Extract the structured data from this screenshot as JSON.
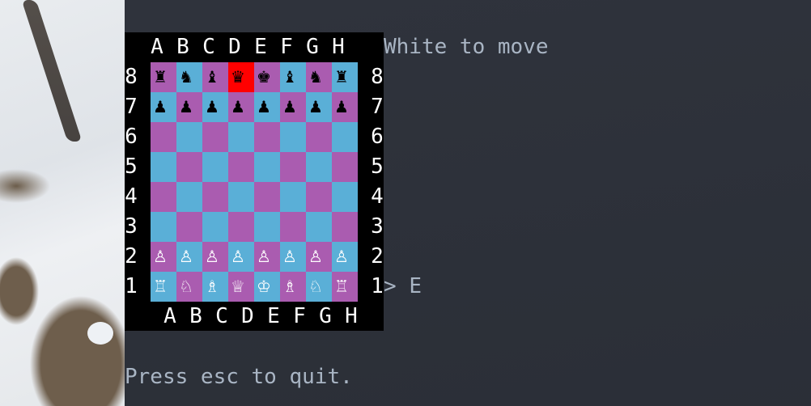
{
  "window": {
    "app": "terminal chess"
  },
  "status": "White to move",
  "prompt": {
    "symbol": ">",
    "input": "E"
  },
  "footer": "Press esc to quit.",
  "colors": {
    "light_square": "#aa5cb0",
    "dark_square": "#5aafd7",
    "highlight": "#ff0000",
    "text": "#a9b5c4",
    "board_frame": "#000000"
  },
  "board": {
    "files_top": [
      "A",
      "B",
      "C",
      "D",
      "E",
      "F",
      "G",
      "H"
    ],
    "files_bottom": [
      "A",
      "B",
      "C",
      "D",
      "E",
      "F",
      "G",
      "H"
    ],
    "ranks": [
      "8",
      "7",
      "6",
      "5",
      "4",
      "3",
      "2",
      "1"
    ],
    "highlighted_square": "D8",
    "rows": [
      [
        "♜",
        "♞",
        "♝",
        "♛",
        "♚",
        "♝",
        "♞",
        "♜"
      ],
      [
        "♟",
        "♟",
        "♟",
        "♟",
        "♟",
        "♟",
        "♟",
        "♟"
      ],
      [
        "",
        "",
        "",
        "",
        "",
        "",
        "",
        ""
      ],
      [
        "",
        "",
        "",
        "",
        "",
        "",
        "",
        ""
      ],
      [
        "",
        "",
        "",
        "",
        "",
        "",
        "",
        ""
      ],
      [
        "",
        "",
        "",
        "",
        "",
        "",
        "",
        ""
      ],
      [
        "♙",
        "♙",
        "♙",
        "♙",
        "♙",
        "♙",
        "♙",
        "♙"
      ],
      [
        "♖",
        "♘",
        "♗",
        "♕",
        "♔",
        "♗",
        "♘",
        "♖"
      ]
    ],
    "piece_colors": [
      "black",
      "black",
      "",
      "",
      "",
      "",
      "white",
      "white"
    ]
  }
}
